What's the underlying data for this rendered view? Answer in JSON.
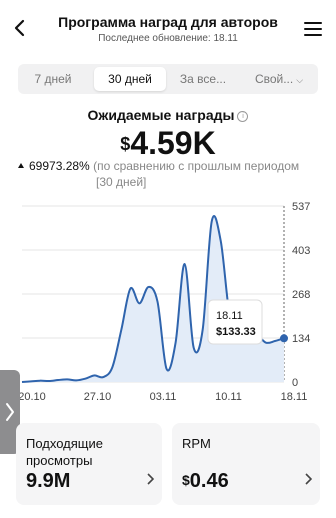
{
  "header": {
    "title": "Программа наград для авторов",
    "subtitle": "Последнее обновление: 18.11"
  },
  "tabs": [
    {
      "label": "7 дней",
      "active": false
    },
    {
      "label": "30 дней",
      "active": true
    },
    {
      "label": "За все...",
      "active": false
    },
    {
      "label": "Свой...",
      "active": false
    }
  ],
  "summary": {
    "label": "Ожидаемые награды",
    "currency": "$",
    "amount": "4.59K",
    "change_pct": "69973.28%",
    "change_text_1": "(по сравнению с прошлым периодом",
    "change_text_2": "[30 дней]"
  },
  "chart_data": {
    "type": "area",
    "x_tick_labels": [
      "20.10",
      "27.10",
      "03.11",
      "10.11",
      "18.11"
    ],
    "y_tick_labels": [
      "0",
      "134",
      "268",
      "403",
      "537"
    ],
    "ylim": [
      0,
      537
    ],
    "x": [
      0,
      1,
      2,
      3,
      4,
      5,
      6,
      7,
      8,
      9,
      10,
      11,
      12,
      13,
      14,
      15,
      16,
      17,
      18,
      19,
      20,
      21,
      22,
      23,
      24,
      25,
      26,
      27,
      28,
      29
    ],
    "values": [
      0,
      2,
      4,
      3,
      6,
      8,
      5,
      10,
      20,
      15,
      45,
      160,
      285,
      240,
      290,
      245,
      40,
      120,
      360,
      105,
      160,
      490,
      430,
      200,
      150,
      155,
      145,
      120,
      125,
      133.33
    ],
    "series": [
      {
        "name": "",
        "values": [
          0,
          2,
          4,
          3,
          6,
          8,
          5,
          10,
          20,
          15,
          45,
          160,
          285,
          240,
          290,
          245,
          40,
          120,
          360,
          105,
          160,
          490,
          430,
          200,
          150,
          155,
          145,
          120,
          125,
          133.33
        ]
      }
    ],
    "tooltip": {
      "date": "18.11",
      "value": "$133.33"
    },
    "colors": {
      "line": "#2f64ad",
      "fill": "#e3ecf8",
      "point": "#2f64ad"
    }
  },
  "cards": [
    {
      "label_1": "Подходящие",
      "label_2": "просмотры",
      "value": "9.9M"
    },
    {
      "label_1": "RPM",
      "currency": "$",
      "value": "0.46"
    }
  ]
}
